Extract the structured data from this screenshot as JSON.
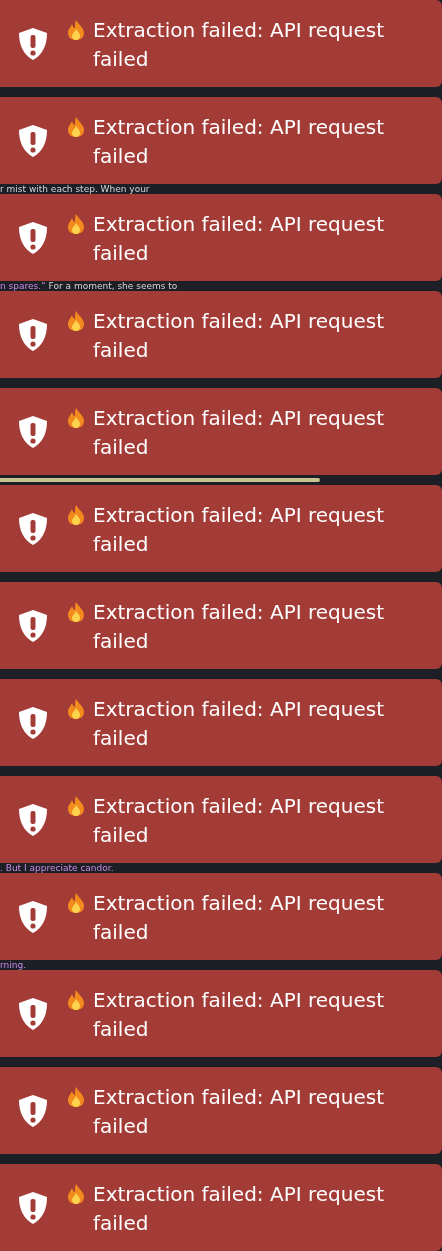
{
  "toasts": [
    {
      "message": "Extraction failed: API request failed"
    },
    {
      "message": "Extraction failed: API request failed"
    },
    {
      "message": "Extraction failed: API request failed"
    },
    {
      "message": "Extraction failed: API request failed"
    },
    {
      "message": "Extraction failed: API request failed"
    },
    {
      "message": "Extraction failed: API request failed"
    },
    {
      "message": "Extraction failed: API request failed"
    },
    {
      "message": "Extraction failed: API request failed"
    },
    {
      "message": "Extraction failed: API request failed"
    },
    {
      "message": "Extraction failed: API request failed"
    },
    {
      "message": "Extraction failed: API request failed"
    },
    {
      "message": "Extraction failed: API request failed"
    },
    {
      "message": "Extraction failed: API request failed"
    }
  ],
  "gaps": [
    {
      "kind": "empty"
    },
    {
      "kind": "text",
      "parts": [
        {
          "text": "r mist with each step. When your",
          "kind": "narration"
        }
      ]
    },
    {
      "kind": "text",
      "parts": [
        {
          "text": "n spares.”",
          "kind": "dialogue"
        },
        {
          "text": " For a moment, she seems to",
          "kind": "narration"
        }
      ]
    },
    {
      "kind": "empty"
    },
    {
      "kind": "bar"
    },
    {
      "kind": "empty"
    },
    {
      "kind": "empty"
    },
    {
      "kind": "empty"
    },
    {
      "kind": "text",
      "parts": [
        {
          "text": ". But I appreciate candor.",
          "kind": "dialogue"
        }
      ]
    },
    {
      "kind": "text",
      "parts": [
        {
          "text": "rning.",
          "kind": "dialogue"
        }
      ]
    },
    {
      "kind": "empty"
    },
    {
      "kind": "empty"
    }
  ]
}
